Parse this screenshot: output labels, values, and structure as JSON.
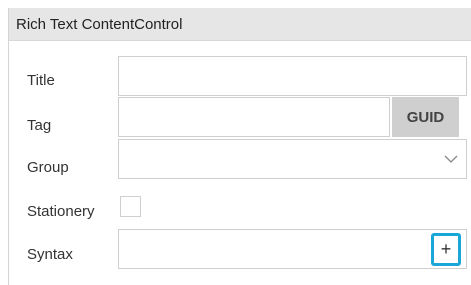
{
  "panel": {
    "title": "Rich Text ContentControl"
  },
  "fields": {
    "title_label": "Title",
    "title_value": "",
    "tag_label": "Tag",
    "tag_value": "",
    "guid_button": "GUID",
    "group_label": "Group",
    "group_value": "",
    "stationery_label": "Stationery",
    "stationery_checked": false,
    "syntax_label": "Syntax",
    "syntax_value": "",
    "add_button": "+"
  },
  "colors": {
    "header_bg": "#e6e6e6",
    "guid_bg": "#cfcfcf",
    "highlight": "#1ba6d8"
  }
}
